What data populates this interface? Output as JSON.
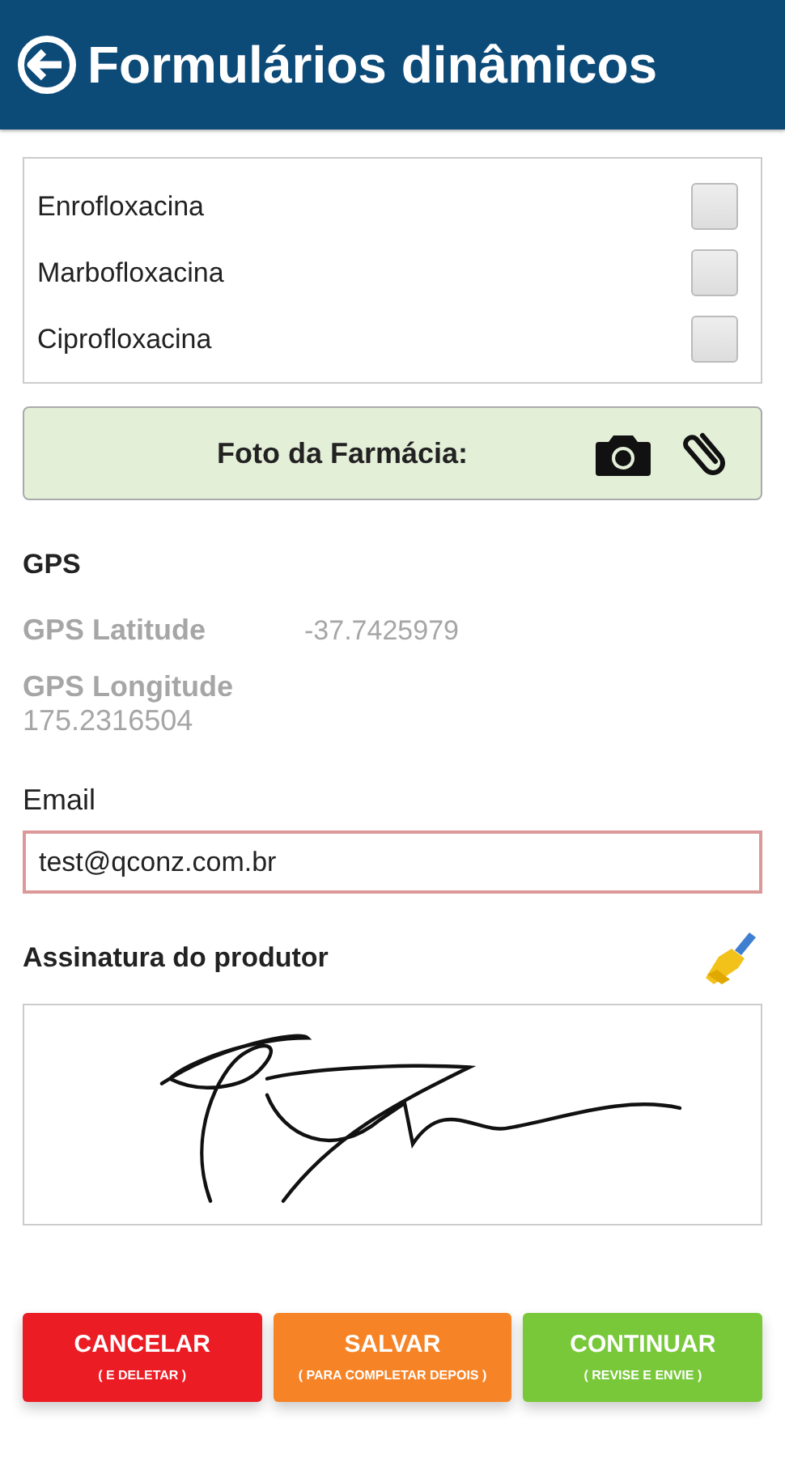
{
  "header": {
    "title": "Formulários dinâmicos"
  },
  "options": [
    {
      "label": "Enrofloxacina",
      "checked": false
    },
    {
      "label": "Marbofloxacina",
      "checked": false
    },
    {
      "label": "Ciprofloxacina",
      "checked": false
    }
  ],
  "photo_field": {
    "label": "Foto da Farmácia:"
  },
  "gps": {
    "title": "GPS",
    "latitude_label": "GPS Latitude",
    "latitude": "-37.7425979",
    "longitude_label": "GPS Longitude",
    "longitude": "175.2316504"
  },
  "email": {
    "label": "Email",
    "value": "test@qconz.com.br",
    "invalid": true
  },
  "signature": {
    "label": "Assinatura do produtor"
  },
  "buttons": [
    {
      "label": "CANCELAR",
      "sublabel": "( E DELETAR )",
      "color": "#ec1c24"
    },
    {
      "label": "SALVAR",
      "sublabel": "( PARA COMPLETAR DEPOIS )",
      "color": "#f68427"
    },
    {
      "label": "CONTINUAR",
      "sublabel": "( REVISE E ENVIE )",
      "color": "#78c83a"
    }
  ]
}
